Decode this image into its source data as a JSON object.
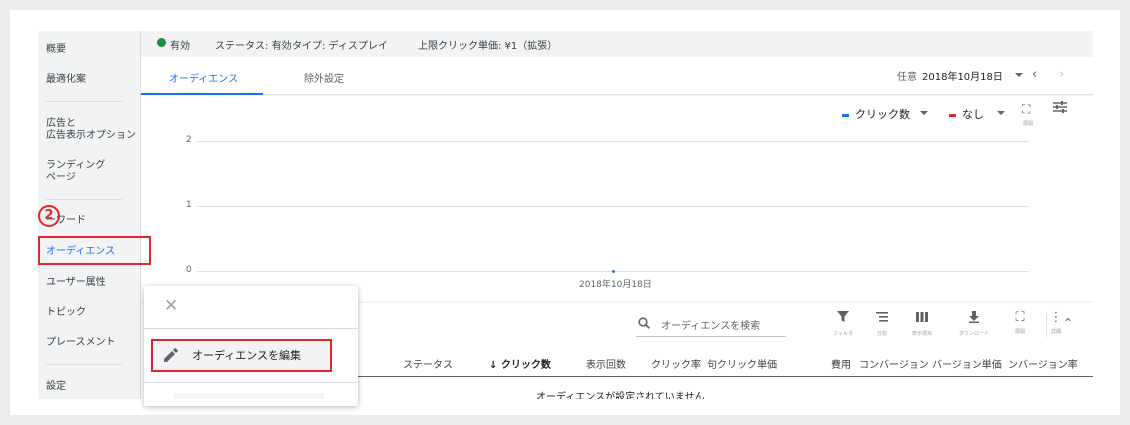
{
  "sidebar": {
    "items": [
      {
        "label": "概要"
      },
      {
        "label": "最適化案"
      },
      {
        "label": "広告と"
      },
      {
        "label": "広告表示オプション"
      },
      {
        "label": "ランディング"
      },
      {
        "label": "ページ"
      },
      {
        "label": "ーワード"
      },
      {
        "label": "オーディエンス",
        "active": true
      },
      {
        "label": "ユーザー属性"
      },
      {
        "label": "トピック"
      },
      {
        "label": "プレースメント"
      },
      {
        "label": "設定"
      }
    ]
  },
  "status": {
    "state": "有効",
    "state_color": "#1e8e3e",
    "status_text": "ステータス: 有効",
    "type_text": "タイプ: ディスプレイ",
    "cpc_text": "上限クリック単価: ¥1（拡張）"
  },
  "tabs": [
    {
      "label": "オーディエンス",
      "active": true
    },
    {
      "label": "除外設定"
    }
  ],
  "date": {
    "label": "任意",
    "value": "2018年10月18日"
  },
  "chart": {
    "metric1": "クリック数",
    "metric1_color": "#1a73e8",
    "metric2": "なし",
    "metric2_color": "#d93025",
    "expand_label": "展開",
    "filter_icon": "tune-icon",
    "expand_icon": "fullscreen-icon"
  },
  "chart_data": {
    "type": "line",
    "x": [
      "2018年10月18日"
    ],
    "series": [
      {
        "values": [
          0
        ]
      }
    ],
    "yticks": [
      "2",
      "1",
      "0"
    ],
    "ylim": [
      0,
      2
    ],
    "grid": true
  },
  "table": {
    "search_placeholder": "オーディエンスを検索",
    "toolbar": [
      {
        "icon": "filter-icon",
        "label": "フィルタ"
      },
      {
        "icon": "segment-icon",
        "label": "分割"
      },
      {
        "icon": "columns-icon",
        "label": "表示項目"
      },
      {
        "icon": "download-icon",
        "label": "ダウンロード"
      },
      {
        "icon": "fullscreen-icon",
        "label": "展開"
      },
      {
        "icon": "more-icon",
        "label": "詳細"
      }
    ],
    "headers": [
      "ステータス",
      "↓ クリック数",
      "表示回数",
      "クリック率",
      "句クリック単価",
      "費用",
      "コンバージョン",
      "バージョン単価",
      "ンバージョン率"
    ],
    "empty_message": "オーディエンスが設定されていません"
  },
  "popup": {
    "edit_label": "オーディエンスを編集"
  },
  "annotation": {
    "step": "2",
    "color": "#e0252b"
  }
}
